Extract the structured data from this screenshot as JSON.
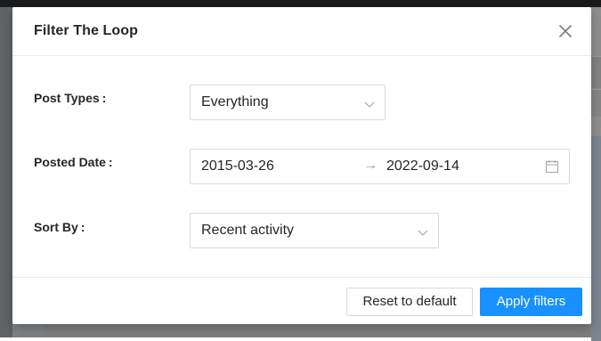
{
  "modal": {
    "title": "Filter The Loop",
    "close_icon": "close-icon"
  },
  "fields": {
    "post_types": {
      "label": "Post Types",
      "colon": ":",
      "value": "Everything",
      "icon": "chevron-down-icon"
    },
    "posted_date": {
      "label": "Posted Date",
      "colon": ":",
      "start": "2015-03-26",
      "separator": "→",
      "end": "2022-09-14",
      "icon": "calendar-icon"
    },
    "sort_by": {
      "label": "Sort By",
      "colon": ":",
      "value": "Recent activity",
      "icon": "chevron-down-icon"
    }
  },
  "footer": {
    "reset_label": "Reset to default",
    "apply_label": "Apply filters"
  },
  "colors": {
    "primary": "#1890ff",
    "border": "#d9d9d9",
    "text": "#262626",
    "overlay": "#7b7b7b"
  }
}
